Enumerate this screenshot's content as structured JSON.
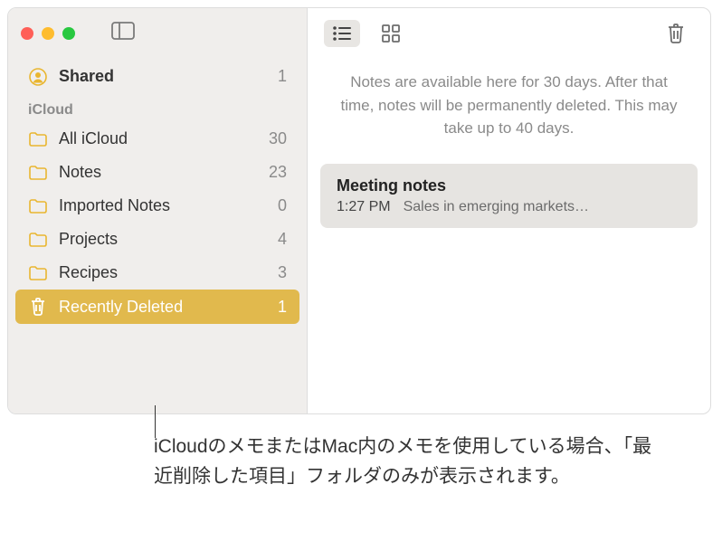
{
  "sidebar": {
    "shared": {
      "label": "Shared",
      "count": "1"
    },
    "section": "iCloud",
    "folders": [
      {
        "label": "All iCloud",
        "count": "30",
        "icon": "folder"
      },
      {
        "label": "Notes",
        "count": "23",
        "icon": "folder"
      },
      {
        "label": "Imported Notes",
        "count": "0",
        "icon": "folder"
      },
      {
        "label": "Projects",
        "count": "4",
        "icon": "folder"
      },
      {
        "label": "Recipes",
        "count": "3",
        "icon": "folder"
      },
      {
        "label": "Recently Deleted",
        "count": "1",
        "icon": "trash",
        "selected": true
      }
    ]
  },
  "main": {
    "info": "Notes are available here for 30 days. After that time, notes will be permanently deleted. This may take up to 40 days.",
    "note": {
      "title": "Meeting notes",
      "time": "1:27 PM",
      "preview": "Sales in emerging markets…"
    }
  },
  "callout": "iCloudのメモまたはMac内のメモを使用している場合、「最近削除した項目」フォルダのみが表示されます。"
}
